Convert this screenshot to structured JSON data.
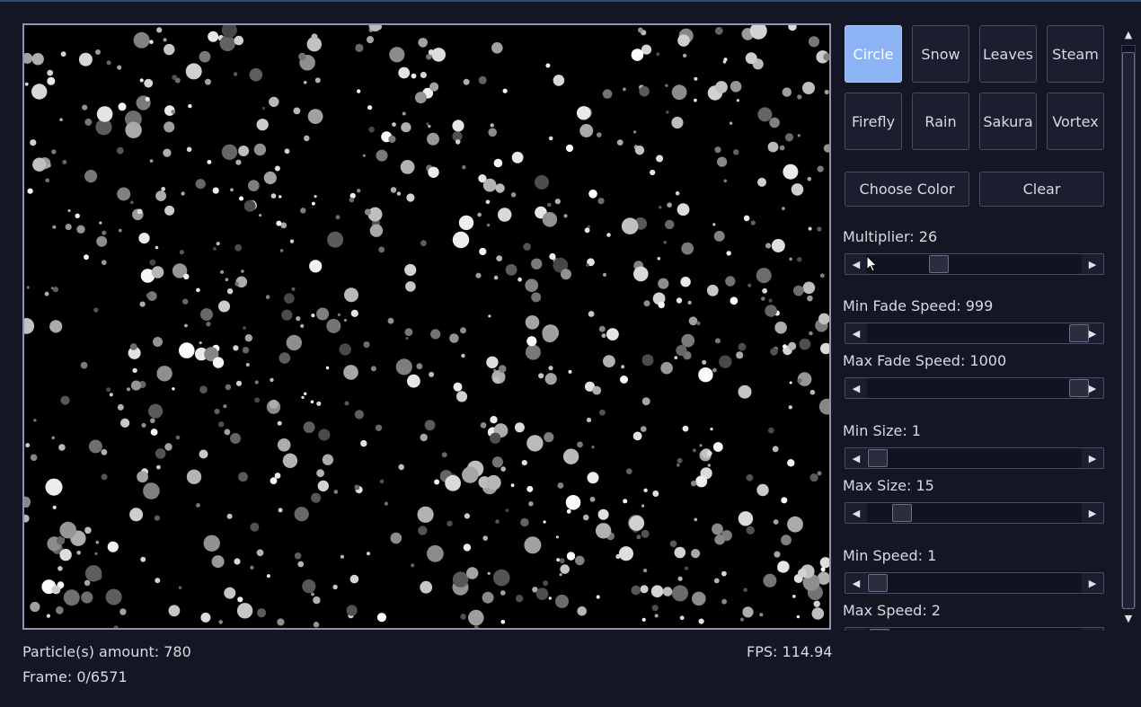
{
  "presets": [
    {
      "label": "Circle",
      "active": true
    },
    {
      "label": "Snow",
      "active": false
    },
    {
      "label": "Leaves",
      "active": false
    },
    {
      "label": "Steam",
      "active": false
    },
    {
      "label": "Firefly",
      "active": false
    },
    {
      "label": "Rain",
      "active": false
    },
    {
      "label": "Sakura",
      "active": false
    },
    {
      "label": "Vortex",
      "active": false
    }
  ],
  "actions": {
    "choose_color": "Choose Color",
    "clear": "Clear"
  },
  "sliders": {
    "multiplier": {
      "label": "Multiplier: 26",
      "value": 26,
      "min": 1,
      "max": 100
    },
    "min_fade_speed": {
      "label": "Min Fade Speed: 999",
      "value": 999,
      "min": 1,
      "max": 1000
    },
    "max_fade_speed": {
      "label": "Max Fade Speed: 1000",
      "value": 1000,
      "min": 1,
      "max": 1000
    },
    "min_size": {
      "label": "Min Size: 1",
      "value": 1,
      "min": 1,
      "max": 100
    },
    "max_size": {
      "label": "Max Size: 15",
      "value": 15,
      "min": 1,
      "max": 100
    },
    "min_speed": {
      "label": "Min Speed: 1",
      "value": 1,
      "min": 1,
      "max": 100
    },
    "max_speed": {
      "label": "Max Speed: 2",
      "value": 2,
      "min": 1,
      "max": 100
    }
  },
  "status": {
    "particles": "Particle(s) amount: 780",
    "frame": "Frame: 0/6571",
    "fps": "FPS: 114.94"
  },
  "particle_count": 780,
  "icons": {
    "left_arrow": "left-arrow-icon",
    "right_arrow": "right-arrow-icon",
    "up_arrow": "up-arrow-icon",
    "down_arrow": "down-arrow-icon",
    "cursor": "mouse-cursor-icon"
  },
  "colors": {
    "background": "#141624",
    "active_button": "#8cb4f5",
    "canvas": "#000000",
    "particle": "#ffffff"
  }
}
